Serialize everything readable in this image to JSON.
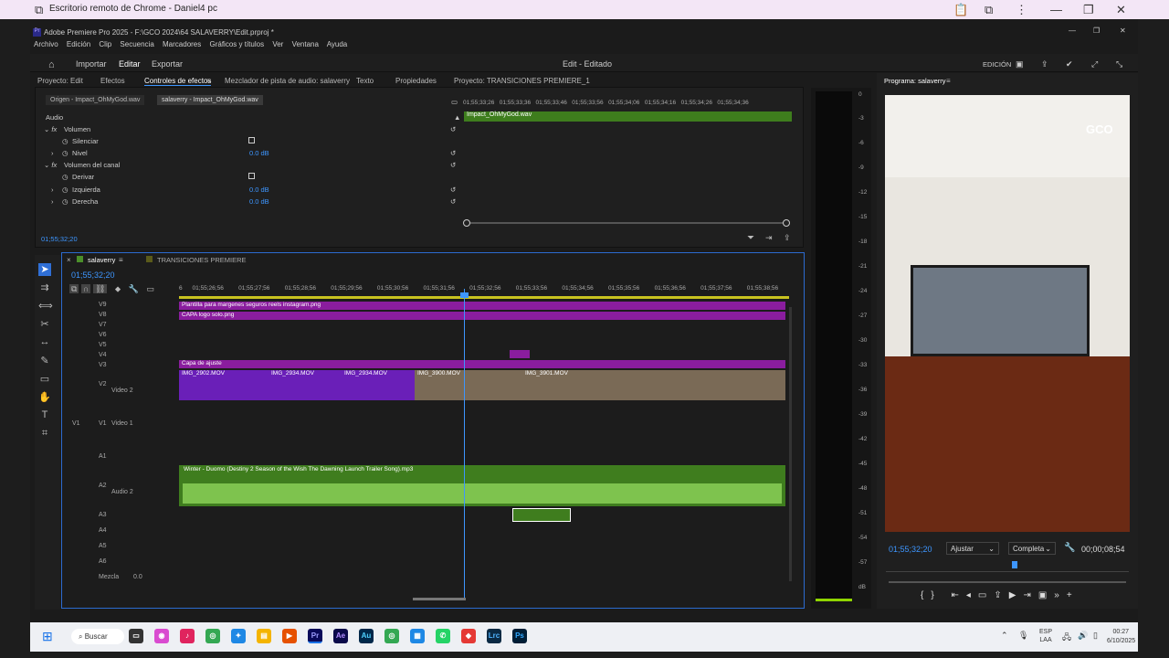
{
  "chrome": {
    "title": "Escritorio remoto de Chrome - Daniel4 pc"
  },
  "premiere": {
    "title": "Adobe Premiere Pro 2025 - F:\\GCO 2024\\64 SALAVERRY\\Edit.prproj *",
    "menu": [
      "Archivo",
      "Edición",
      "Clip",
      "Secuencia",
      "Marcadores",
      "Gráficos y títulos",
      "Ver",
      "Ventana",
      "Ayuda"
    ],
    "workspace": {
      "importar": "Importar",
      "editar": "Editar",
      "exportar": "Exportar",
      "center": "Edit - Editado",
      "edicion": "EDICIÓN"
    },
    "tabs": [
      "Proyecto: Edit",
      "Efectos",
      "Controles de efectos",
      "Mezclador de pista de audio: salaverry",
      "Texto",
      "Propiedades",
      "Proyecto: TRANSICIONES PREMIERE_1"
    ],
    "source_tabs": [
      "Origen - Impact_OhMyGod.wav",
      "salaverry - Impact_OhMyGod.wav"
    ],
    "effect_controls": {
      "section": "Audio",
      "rows": [
        {
          "label": "Volumen",
          "value": ""
        },
        {
          "label": "Silenciar",
          "value": ""
        },
        {
          "label": "Nivel",
          "value": "0.0 dB"
        },
        {
          "label": "Volumen del canal",
          "value": ""
        },
        {
          "label": "Derivar",
          "value": ""
        },
        {
          "label": "Izquierda",
          "value": "0.0 dB"
        },
        {
          "label": "Derecha",
          "value": "0.0 dB"
        }
      ],
      "clip_name": "Impact_OhMyGod.wav",
      "ruler": [
        "01;55;33;26",
        "01;55;33;36",
        "01;55;33;46",
        "01;55;33;56",
        "01;55;34;06",
        "01;55;34;16",
        "01;55;34;26",
        "01;55;34;36"
      ],
      "timecode": "01;55;32;20"
    },
    "timeline": {
      "tabs": [
        "salaverry",
        "TRANSICIONES PREMIERE"
      ],
      "timecode": "01;55;32;20",
      "ruler": [
        "6",
        "01;55;26;56",
        "01;55;27;56",
        "01;55;28;56",
        "01;55;29;56",
        "01;55;30;56",
        "01;55;31;56",
        "01;55;32;56",
        "01;55;33;56",
        "01;55;34;56",
        "01;55;35;56",
        "01;55;36;56",
        "01;55;37;56",
        "01;55;38;56"
      ],
      "video_tracks": [
        "V9",
        "V8",
        "V7",
        "V6",
        "V5",
        "V4",
        "V3",
        "V2",
        "V1"
      ],
      "v2_name": "Video 2",
      "v1_name": "Video 1",
      "audio_tracks": [
        "A1",
        "A2",
        "A3",
        "A4",
        "A5",
        "A6"
      ],
      "a2_name": "Audio 2",
      "mix_label": "Mezcla",
      "mix_value": "0.0",
      "clips": {
        "v9": "Plantilla para margenes seguros reels instagram.png",
        "v8": "CAPA logo solo.png",
        "v3": "Capa de ajuste",
        "v2a": "IMG_2902.MOV",
        "v2b": "IMG_2934.MOV",
        "v2c": "IMG_2934.MOV",
        "v2d": "IMG_3900.MOV",
        "v2e": "IMG_3901.MOV",
        "a2": "Winter - Duomo (Destiny 2 Season of the Wish The Dawning Launch Trailer Song).mp3"
      }
    },
    "meter_ticks": [
      "0",
      "-3",
      "-6",
      "-9",
      "-12",
      "-15",
      "-18",
      "-21",
      "-24",
      "-27",
      "-30",
      "-33",
      "-36",
      "-39",
      "-42",
      "-45",
      "-48",
      "-51",
      "-54",
      "-57",
      "dB"
    ],
    "program": {
      "title": "Programa: salaverry",
      "logo": "GCO",
      "timecode": "01;55;32;20",
      "fit": "Ajustar",
      "quality": "Completa",
      "duration": "00;00;08;54"
    }
  },
  "taskbar": {
    "search": "Buscar",
    "lang1": "ESP",
    "lang2": "LAA",
    "time": "00:27",
    "date": "6/10/2025"
  }
}
